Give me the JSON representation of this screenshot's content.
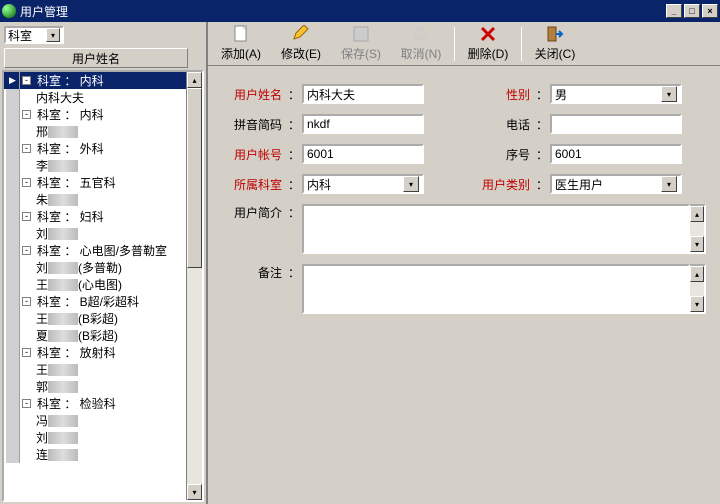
{
  "window": {
    "title": "用户管理"
  },
  "left": {
    "filter_label": "科室",
    "column_header": "用户姓名",
    "rows": [
      {
        "type": "group",
        "selected": true,
        "text": "科室 ： 内科"
      },
      {
        "type": "item",
        "text": "内科大夫"
      },
      {
        "type": "group",
        "text": "科室 ： 内科"
      },
      {
        "type": "item",
        "text": "邢",
        "blur": true
      },
      {
        "type": "group",
        "text": "科室 ： 外科"
      },
      {
        "type": "item",
        "text": "李",
        "blur": true
      },
      {
        "type": "group",
        "text": "科室 ： 五官科"
      },
      {
        "type": "item",
        "text": "朱",
        "blur": true
      },
      {
        "type": "group",
        "text": "科室 ： 妇科"
      },
      {
        "type": "item",
        "text": "刘",
        "blur": true
      },
      {
        "type": "group",
        "text": "科室 ： 心电图/多普勒室"
      },
      {
        "type": "item",
        "text": "刘",
        "blur": true,
        "suffix": "(多普勒)"
      },
      {
        "type": "item",
        "text": "王",
        "blur": true,
        "suffix": "(心电图)"
      },
      {
        "type": "group",
        "text": "科室 ： B超/彩超科"
      },
      {
        "type": "item",
        "text": "王",
        "blur": true,
        "suffix": "(B彩超)"
      },
      {
        "type": "item",
        "text": "夏",
        "blur": true,
        "suffix": "(B彩超)"
      },
      {
        "type": "group",
        "text": "科室 ： 放射科"
      },
      {
        "type": "item",
        "text": "王",
        "blur": true
      },
      {
        "type": "item",
        "text": "郭",
        "blur": true
      },
      {
        "type": "group",
        "text": "科室 ： 检验科"
      },
      {
        "type": "item",
        "text": "冯",
        "blur": true
      },
      {
        "type": "item",
        "text": "刘",
        "blur": true
      },
      {
        "type": "item",
        "text": "连",
        "blur": true
      }
    ]
  },
  "toolbar": {
    "add": "添加(A)",
    "edit": "修改(E)",
    "save": "保存(S)",
    "cancel": "取消(N)",
    "delete": "删除(D)",
    "close": "关闭(C)"
  },
  "form": {
    "labels": {
      "username": "用户姓名",
      "gender": "性别",
      "pinyin": "拼音简码",
      "phone": "电话",
      "account": "用户帐号",
      "seq": "序号",
      "dept": "所属科室",
      "usertype": "用户类别",
      "intro": "用户简介",
      "remark": "备注"
    },
    "values": {
      "username": "内科大夫",
      "gender": "男",
      "pinyin": "nkdf",
      "phone": "",
      "account": "6001",
      "seq": "6001",
      "dept": "内科",
      "usertype": "医生用户",
      "intro": "",
      "remark": ""
    }
  }
}
